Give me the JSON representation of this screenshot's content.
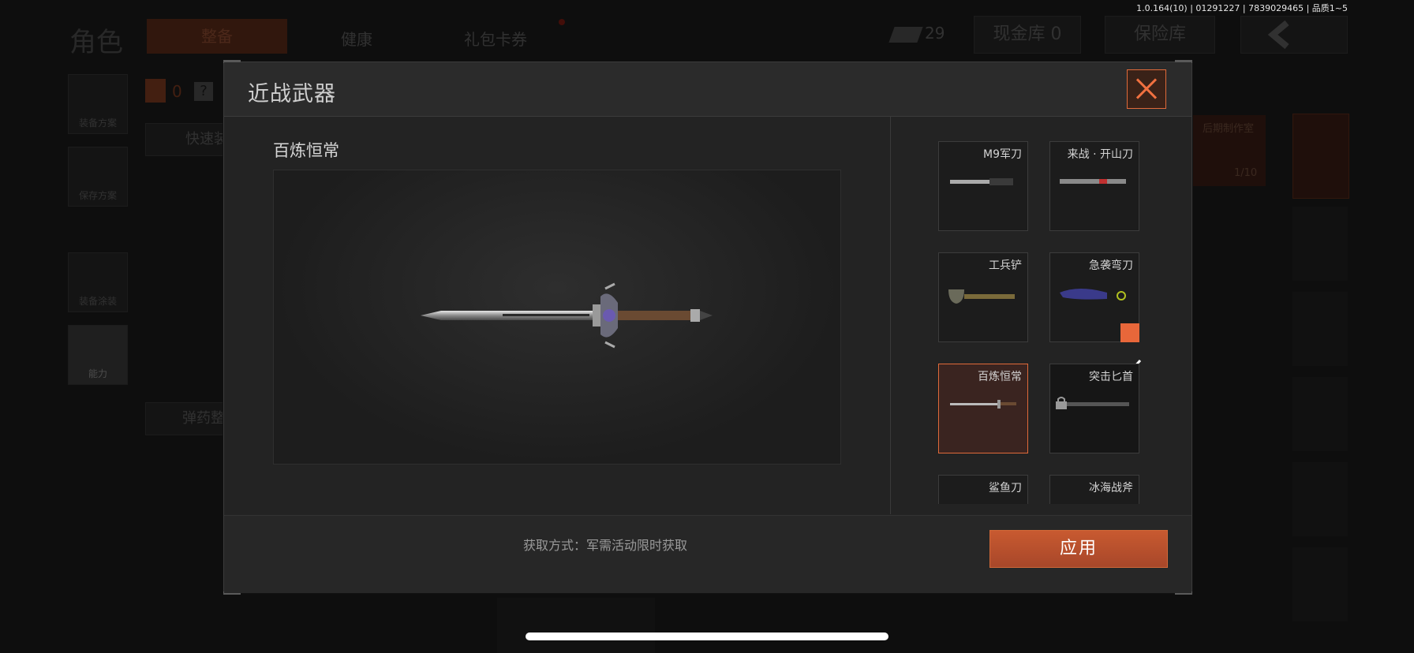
{
  "version_text": "1.0.164(10) | 01291227 | 7839029465 | 品质1~5",
  "background": {
    "page_title": "角色",
    "tabs": [
      "整备",
      "健康",
      "礼包卡券"
    ],
    "currency_count": "29",
    "vault_label": "现金库 0",
    "insurance_label": "保险库",
    "side_buttons": [
      "装备方案",
      "保存方案",
      "装备涂装",
      "能力"
    ],
    "quick_equip": "快速装",
    "ammo": "弹药整",
    "backpack_count": "0",
    "question": "?",
    "craft_label": "后期制作室",
    "craft_count": "1/10"
  },
  "modal": {
    "title": "近战武器",
    "preview_name": "百炼恒常",
    "acquire_text": "获取方式：军需活动限时获取",
    "apply_label": "应用",
    "weapons": [
      {
        "name": "M9军刀",
        "state": "normal",
        "icon": "knife-icon"
      },
      {
        "name": "来战 · 开山刀",
        "state": "normal",
        "icon": "machete-icon"
      },
      {
        "name": "工兵铲",
        "state": "normal",
        "icon": "shovel-icon"
      },
      {
        "name": "急袭弯刀",
        "state": "equipped",
        "icon": "karambit-icon"
      },
      {
        "name": "百炼恒常",
        "state": "selected",
        "icon": "sword-icon"
      },
      {
        "name": "突击匕首",
        "state": "locked",
        "icon": "dagger-icon"
      },
      {
        "name": "鲨鱼刀",
        "state": "normal",
        "icon": "knife-icon"
      },
      {
        "name": "冰海战斧",
        "state": "normal",
        "icon": "axe-icon"
      }
    ]
  },
  "colors": {
    "accent": "#e8673a",
    "panel": "#232323"
  }
}
